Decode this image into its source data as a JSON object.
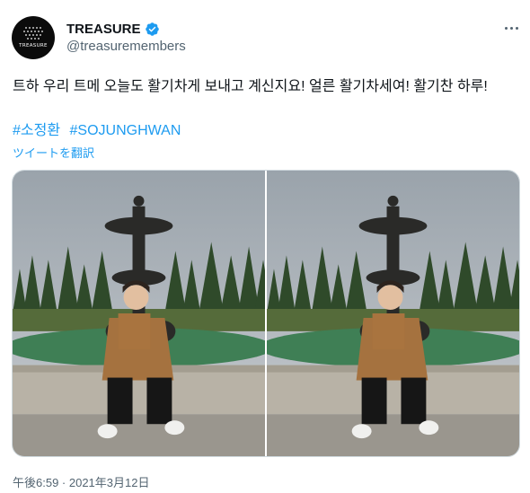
{
  "author": {
    "display_name": "TREASURE",
    "handle": "@treasuremembers",
    "avatar_logo": "TREASURE",
    "verified": true
  },
  "tweet": {
    "text": "트하 우리 트메 오늘도 활기차게 보내고 계신지요! 얼른 활기차세여! 활기찬 하루!",
    "hashtags": [
      "#소정환",
      "#SOJUNGHWAN"
    ],
    "translate_label": "ツイートを翻訳",
    "timestamp": "午後6:59 · 2021年3月12日"
  },
  "media": {
    "photo_count": 2
  },
  "colors": {
    "link": "#1d9bf0",
    "verified": "#1d9bf0",
    "text": "#0f1419",
    "muted": "#536471"
  },
  "icons": [
    "verified-badge-icon",
    "more-options-icon"
  ]
}
